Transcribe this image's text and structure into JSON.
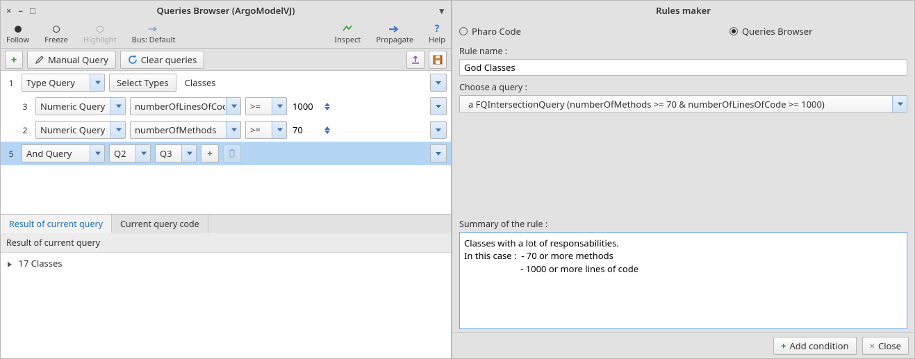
{
  "left": {
    "title": "Queries Browser (ArgoModelVJ)",
    "toolbar": {
      "follow": "Follow",
      "freeze": "Freeze",
      "highlight": "Highlight",
      "bus": "Bus: Default",
      "inspect": "Inspect",
      "propagate": "Propagate",
      "help": "Help"
    },
    "subbar": {
      "manual_query": "Manual Query",
      "clear_queries": "Clear queries"
    },
    "queries": {
      "r1": {
        "num": "1",
        "type": "Type Query",
        "select_types_btn": "Select Types",
        "summary": "Classes"
      },
      "r3": {
        "num": "3",
        "type": "Numeric Query",
        "property": "numberOfLinesOfCode",
        "op": ">=",
        "val": "1000"
      },
      "r2": {
        "num": "2",
        "type": "Numeric Query",
        "property": "numberOfMethods",
        "op": ">=",
        "val": "70"
      },
      "r5": {
        "num": "5",
        "type": "And Query",
        "a": "Q2",
        "b": "Q3"
      }
    },
    "tabs": {
      "a": "Result of current query",
      "b": "Current query code"
    },
    "result_head": "Result of current query",
    "result_line": "17 Classes"
  },
  "right": {
    "title": "Rules maker",
    "radios": {
      "pharo": "Pharo Code",
      "qb": "Queries Browser",
      "selected": "qb"
    },
    "rule_name_label": "Rule name :",
    "rule_name_value": "God Classes",
    "choose_label": "Choose a query :",
    "choose_value": "a FQIntersectionQuery (numberOfMethods >= 70 & numberOfLinesOfCode >= 1000)",
    "summary_label": "Summary of the rule :",
    "summary_value": "Classes with a lot of responsabilities.\nIn this case :  - 70 or more methods\n                        - 1000 or more lines of code",
    "add_condition": "Add condition",
    "close": "Close"
  }
}
